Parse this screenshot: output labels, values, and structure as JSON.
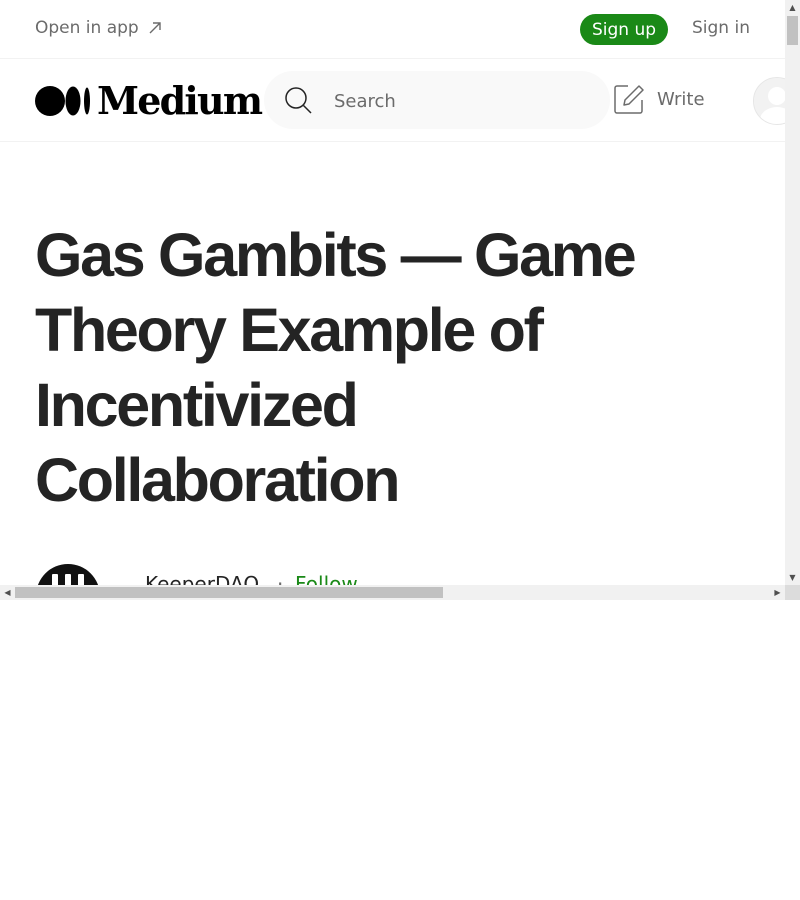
{
  "top_bar": {
    "open_in_app": "Open in app",
    "sign_up": "Sign up",
    "sign_in": "Sign in"
  },
  "header": {
    "logo_text": "Medium",
    "search_placeholder": "Search",
    "write_label": "Write"
  },
  "article": {
    "title": "Gas Gambits — Game Theory Example of Incentivized Collaboration",
    "author": "KeeperDAO",
    "separator": "·",
    "follow": "Follow"
  },
  "icons": {
    "open_in_app": "arrow-up-right-icon",
    "search": "search-icon",
    "write": "write-icon",
    "avatar": "user-avatar-icon"
  },
  "colors": {
    "brand_green": "#1a8917",
    "text_primary": "#242424",
    "text_secondary": "#6b6b6b",
    "search_bg": "#f9f9f9"
  }
}
